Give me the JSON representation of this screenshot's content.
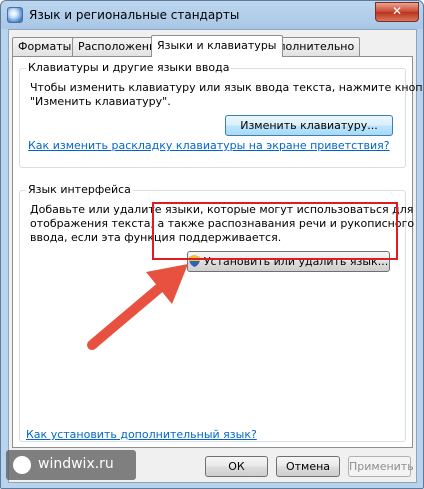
{
  "window": {
    "title": "Язык и региональные стандарты",
    "close_glyph": "✕"
  },
  "tabs": [
    {
      "label": "Форматы",
      "active": false
    },
    {
      "label": "Расположение",
      "active": false
    },
    {
      "label": "Языки и клавиатуры",
      "active": true
    },
    {
      "label": "Дополнительно",
      "active": false
    }
  ],
  "keyboards": {
    "title": "Клавиатуры и другие языки ввода",
    "desc_line1": "Чтобы изменить клавиатуру или язык ввода текста, нажмите кнопку",
    "desc_line2": "\"Изменить клавиатуру\".",
    "button": "Изменить клавиатуру...",
    "link": "Как изменить раскладку клавиатуры на экране приветствия?"
  },
  "interface_language": {
    "title": "Язык интерфейса",
    "desc_line1": "Добавьте или удалите языки, которые могут использоваться для",
    "desc_line2": "отображения текста, а также распознавания речи и рукописного",
    "desc_line3": "ввода, если эта функция поддерживается.",
    "button": "Установить или удалить язык..."
  },
  "bottom_link": "Как установить дополнительный язык?",
  "buttons": {
    "ok": "ОК",
    "cancel": "Отмена",
    "apply": "Применить"
  },
  "watermark": "windwix.ru",
  "colors": {
    "highlight_box": "#e11b22",
    "arrow": "#e8503f",
    "link": "#0066cc"
  }
}
